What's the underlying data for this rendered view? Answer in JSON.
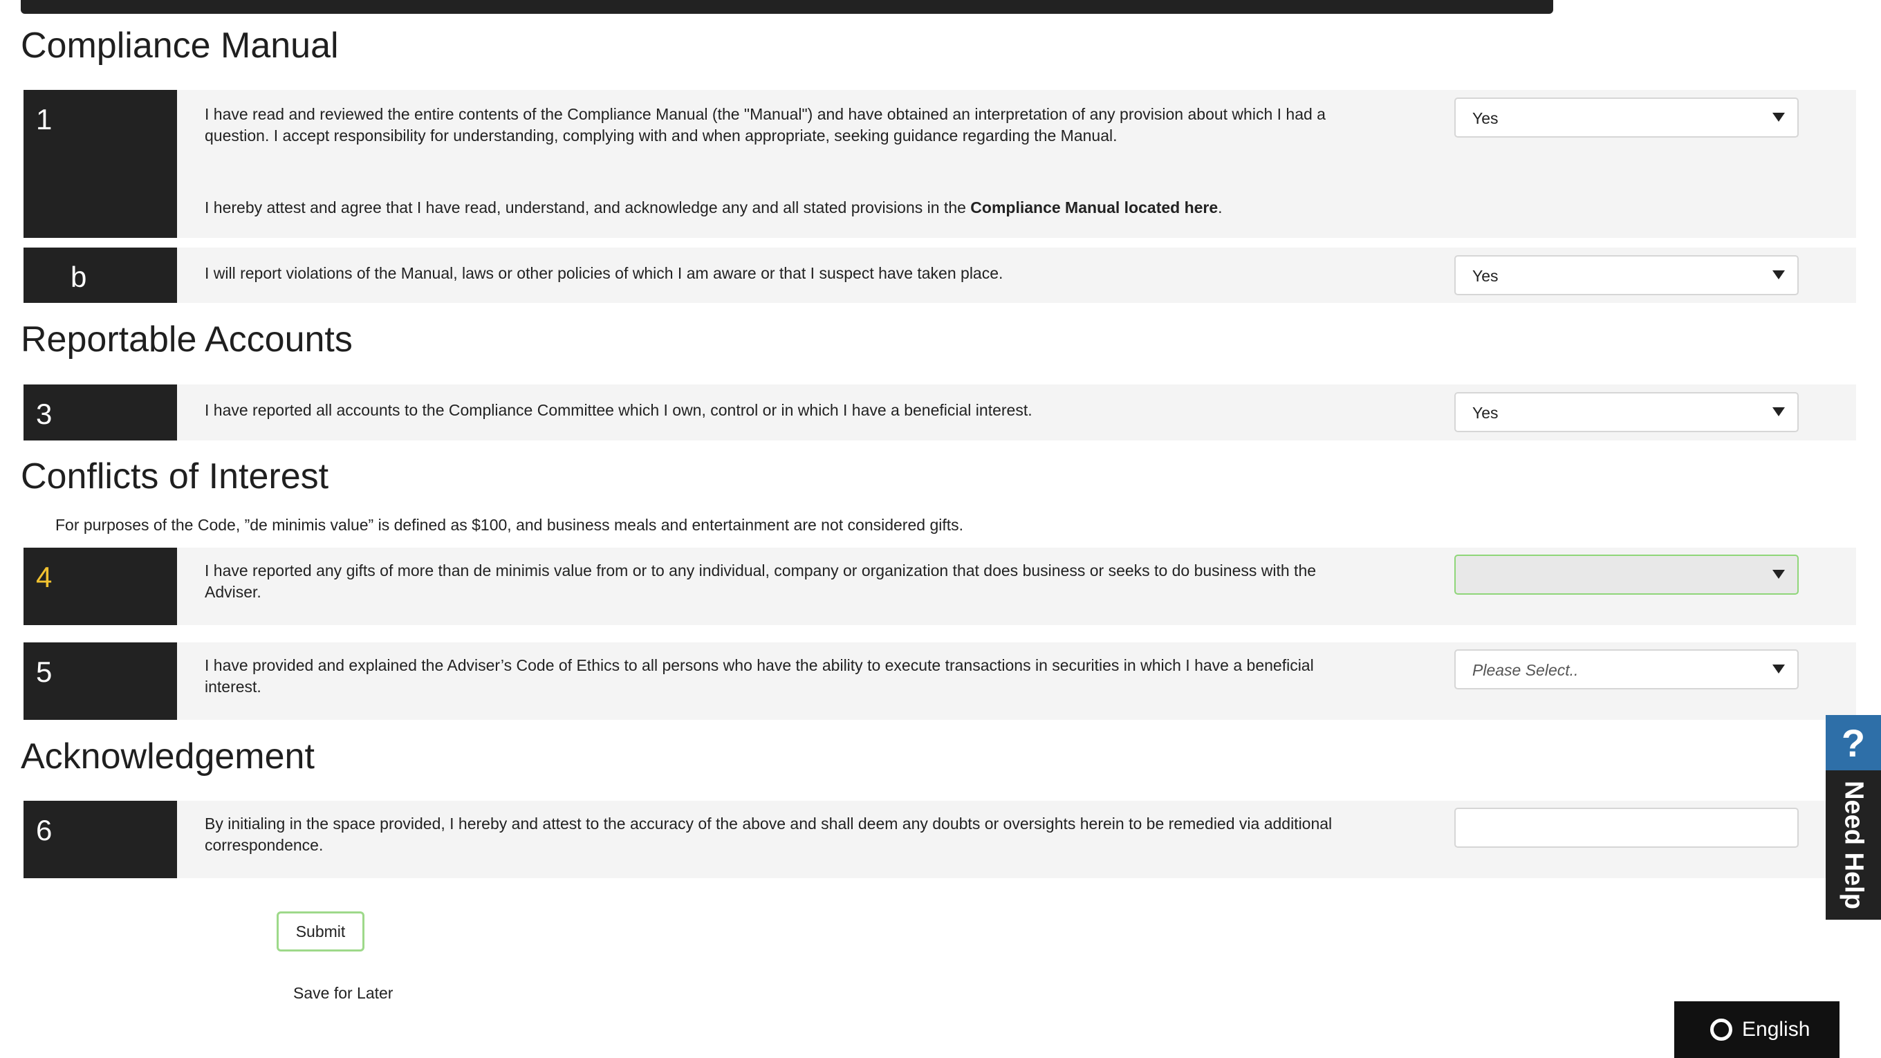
{
  "sections": {
    "compliance": "Compliance Manual",
    "reportable": "Reportable Accounts",
    "conflicts": "Conflicts of Interest",
    "acknowledgement": "Acknowledgement"
  },
  "questions": [
    {
      "number": "1",
      "text": "I have read and reviewed the entire contents of the Compliance Manual (the \"Manual\") and have obtained an interpretation of any provision about which I had a question. I accept responsibility for understanding, complying with and when appropriate, seeking guidance regarding the Manual.",
      "text2_pre": "I hereby attest and agree that I have read, understand, and acknowledge any and all stated provisions in the ",
      "text2_link": "Compliance Manual located here",
      "text2_post": ".",
      "answer": "Yes"
    },
    {
      "number": "b",
      "text": "I will report violations of the Manual, laws or other  policies of which I am aware or that I suspect have taken place.",
      "answer": "Yes"
    },
    {
      "number": "3",
      "text": "I have reported all accounts to the Compliance Committee which I own, control or in which I have a beneficial interest.",
      "answer": "Yes"
    },
    {
      "number": "4",
      "text": "I have reported any gifts of more than de minimis value from or to any individual, company or organization that does business or seeks to do business with the Adviser.",
      "answer": ""
    },
    {
      "number": "5",
      "text": "I have provided and explained the Adviser’s Code of Ethics to all persons who have the ability to execute transactions in securities in which I have a beneficial interest.",
      "answer_placeholder": "Please Select.."
    },
    {
      "number": "6",
      "text": "By initialing in the space provided, I hereby and attest to the accuracy of the above and shall deem any doubts or oversights herein to be remedied via additional correspondence.",
      "initials": ""
    }
  ],
  "conflicts_note": "For purposes of the Code, ”de minimis value” is defined as $100, and business meals and entertainment are not considered gifts.",
  "buttons": {
    "submit": "Submit",
    "save_later": "Save for Later"
  },
  "help_widget": {
    "icon": "?",
    "label": "Need Help"
  },
  "language": {
    "label": "English",
    "icon": "globe-ring-icon"
  },
  "colors": {
    "number_block": "#222222",
    "active_number": "#f2c230",
    "active_select_border": "#8fd679",
    "help_blue": "#2e6fa8"
  }
}
